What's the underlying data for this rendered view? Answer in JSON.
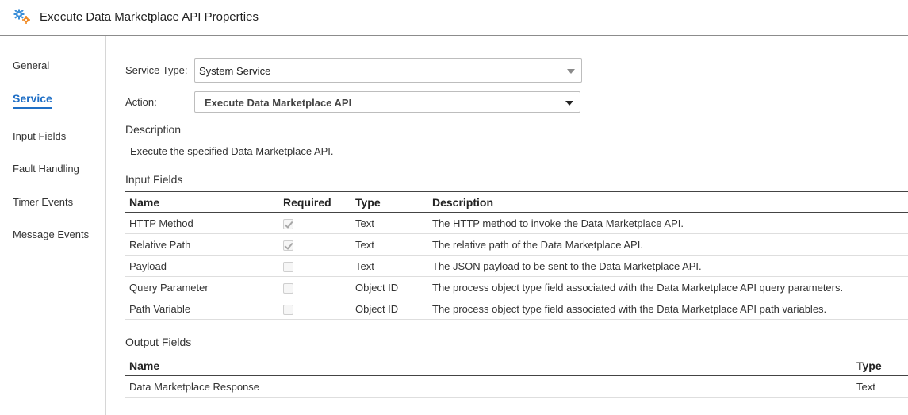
{
  "window": {
    "title": "Execute Data Marketplace API Properties",
    "icon": "gear-icon"
  },
  "sidebar": {
    "items": [
      {
        "label": "General",
        "active": false
      },
      {
        "label": "Service",
        "active": true
      },
      {
        "label": "Input Fields",
        "active": false
      },
      {
        "label": "Fault Handling",
        "active": false
      },
      {
        "label": "Timer Events",
        "active": false
      },
      {
        "label": "Message Events",
        "active": false
      }
    ]
  },
  "form": {
    "service_type_label": "Service Type:",
    "service_type_value": "System Service",
    "action_label": "Action:",
    "action_value": "Execute Data Marketplace API"
  },
  "description": {
    "heading": "Description",
    "text": "Execute the specified Data Marketplace API."
  },
  "input_fields": {
    "heading": "Input Fields",
    "columns": [
      "Name",
      "Required",
      "Type",
      "Description"
    ],
    "rows": [
      {
        "name": "HTTP Method",
        "required": true,
        "type": "Text",
        "description": "The HTTP method to invoke the Data Marketplace API."
      },
      {
        "name": "Relative Path",
        "required": true,
        "type": "Text",
        "description": "The relative path of the Data Marketplace API."
      },
      {
        "name": "Payload",
        "required": false,
        "type": "Text",
        "description": "The JSON payload to be sent to the Data Marketplace API."
      },
      {
        "name": "Query Parameter",
        "required": false,
        "type": "Object ID",
        "description": "The process object type field associated with the Data Marketplace API query parameters."
      },
      {
        "name": "Path Variable",
        "required": false,
        "type": "Object ID",
        "description": "The process object type field associated with the Data Marketplace API path variables."
      }
    ]
  },
  "output_fields": {
    "heading": "Output Fields",
    "columns": [
      "Name",
      "Type"
    ],
    "rows": [
      {
        "name": "Data Marketplace Response",
        "type": "Text"
      }
    ]
  },
  "colors": {
    "accent": "#1f6fc6",
    "icon_blue": "#3b8fd8",
    "icon_orange": "#f08a24"
  }
}
